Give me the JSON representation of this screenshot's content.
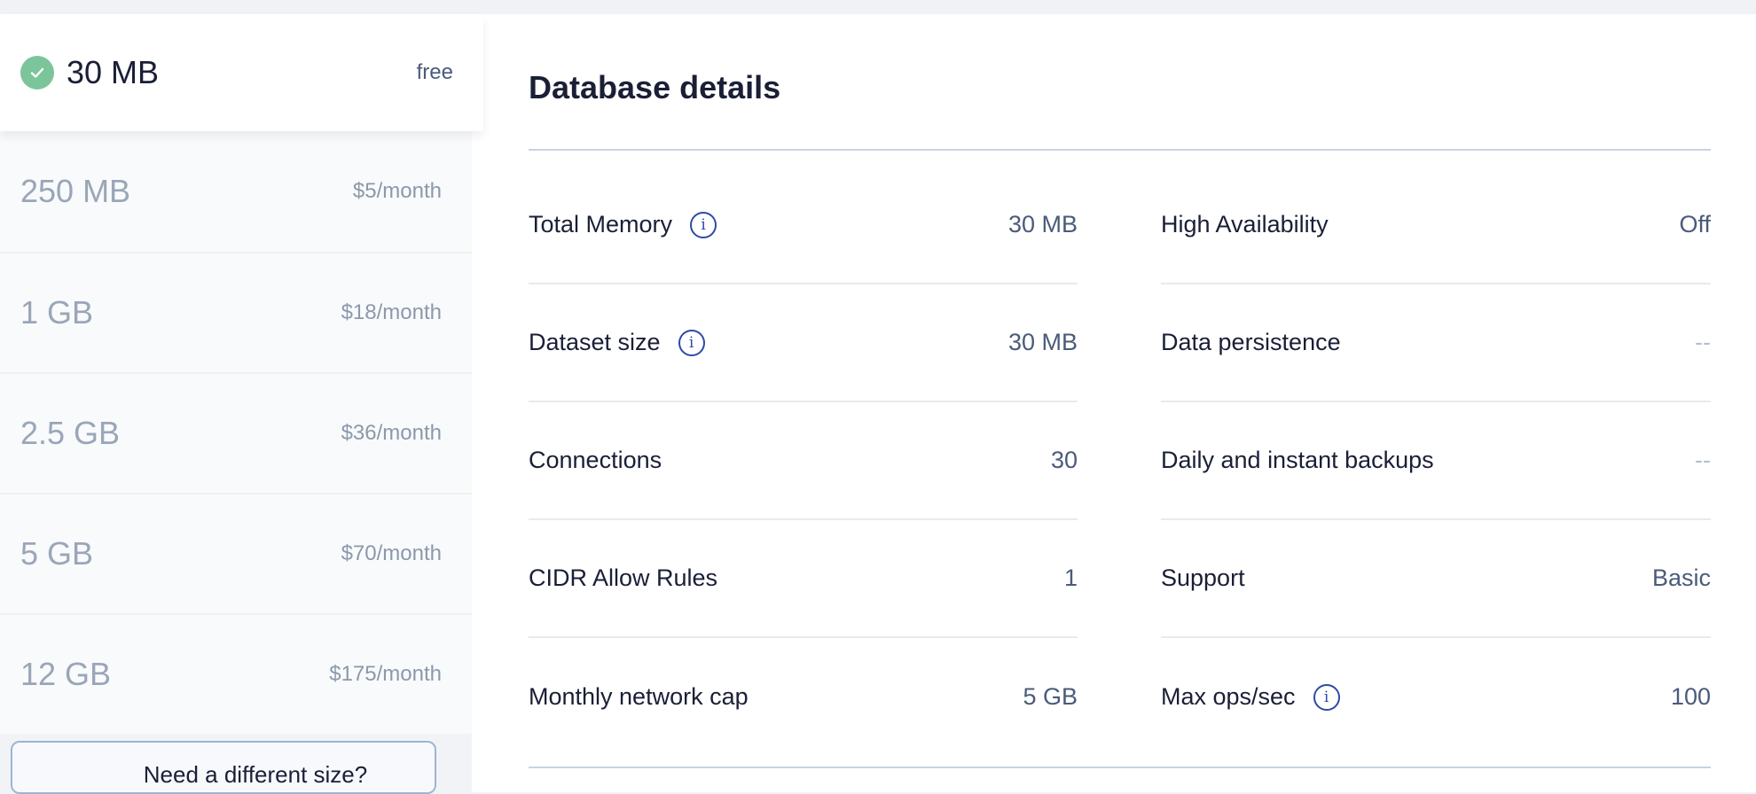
{
  "plans": [
    {
      "size": "30 MB",
      "price": "free",
      "selected": true
    },
    {
      "size": "250 MB",
      "price": "$5/month"
    },
    {
      "size": "1 GB",
      "price": "$18/month"
    },
    {
      "size": "2.5 GB",
      "price": "$36/month"
    },
    {
      "size": "5 GB",
      "price": "$70/month"
    },
    {
      "size": "12 GB",
      "price": "$175/month"
    }
  ],
  "different_size_button": "Need a different size?",
  "details": {
    "title": "Database details",
    "left": [
      {
        "label": "Total Memory",
        "value": "30 MB",
        "info": true
      },
      {
        "label": "Dataset size",
        "value": "30 MB",
        "info": true
      },
      {
        "label": "Connections",
        "value": "30"
      },
      {
        "label": "CIDR Allow Rules",
        "value": "1"
      },
      {
        "label": "Monthly network cap",
        "value": "5 GB"
      }
    ],
    "right": [
      {
        "label": "High Availability",
        "value": "Off"
      },
      {
        "label": "Data persistence",
        "value": "--"
      },
      {
        "label": "Daily and instant backups",
        "value": "--"
      },
      {
        "label": "Support",
        "value": "Basic"
      },
      {
        "label": "Max ops/sec",
        "value": "100",
        "info": true
      }
    ]
  },
  "colors": {
    "check_green": "#7cc59a",
    "info_blue": "#2e4aa8",
    "value_slate": "#4a5b7a"
  }
}
